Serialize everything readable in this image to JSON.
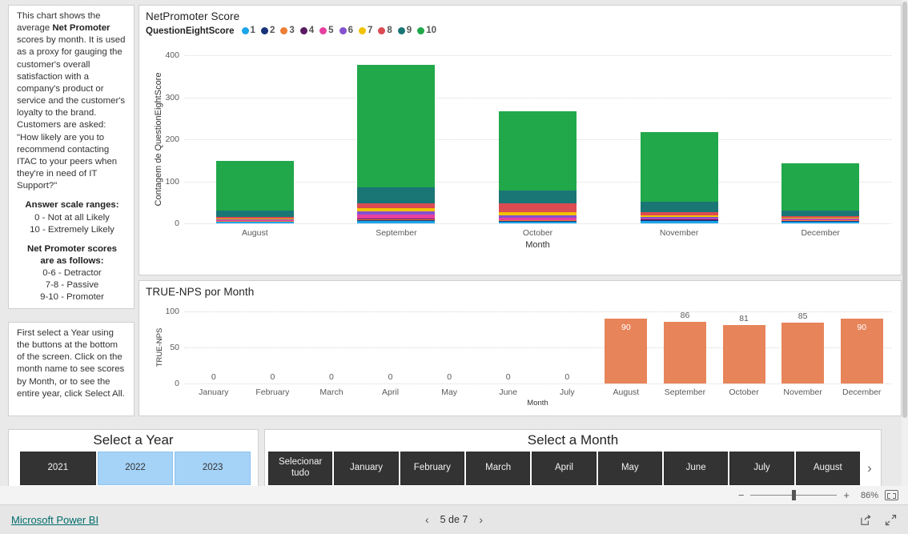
{
  "description_panel": {
    "paragraph": "This chart shows the average Net Promoter scores by month. It is used as a proxy for gauging the customer's overall satisfaction with a company's product or service and the customer's loyalty to the brand. Customers are asked: \"How likely are you to recommend contacting ITAC to your peers when they're in need of IT Support?\"",
    "scale_heading": "Answer scale ranges:",
    "scale_line1": "0 - Not at all Likely",
    "scale_line2": "10 - Extremely Likely",
    "nps_heading_line1": "Net Promoter scores",
    "nps_heading_line2": "are as follows:",
    "nps_line1": "0-6 - Detractor",
    "nps_line2": "7-8 - Passive",
    "nps_line3": "9-10 - Promoter"
  },
  "instructions_panel": {
    "text": "First select a Year using the buttons at the bottom of the screen. Click on the month name to see scores by Month, or to see the entire year, click Select All."
  },
  "chart_data": [
    {
      "id": "net_promoter_score",
      "type": "bar",
      "stacked": true,
      "title": "NetPromoter Score",
      "legend_title": "QuestionEightScore",
      "legend_position": "top",
      "xlabel": "Month",
      "ylabel": "Contagem de QuestionEightScore",
      "ylim": [
        0,
        400
      ],
      "yticks": [
        0,
        100,
        200,
        300,
        400
      ],
      "grid": true,
      "categories": [
        "August",
        "September",
        "October",
        "November",
        "December"
      ],
      "series": [
        {
          "name": "1",
          "color": "#1CA5E8",
          "values": [
            3,
            5,
            3,
            5,
            4
          ]
        },
        {
          "name": "2",
          "color": "#17347A",
          "values": [
            1,
            3,
            2,
            2,
            2
          ]
        },
        {
          "name": "3",
          "color": "#EE7D36",
          "values": [
            1,
            2,
            2,
            1,
            1
          ]
        },
        {
          "name": "4",
          "color": "#5A1A62",
          "values": [
            1,
            2,
            1,
            1,
            1
          ]
        },
        {
          "name": "5",
          "color": "#E63FA0",
          "values": [
            2,
            9,
            6,
            3,
            2
          ]
        },
        {
          "name": "6",
          "color": "#8452CE",
          "values": [
            2,
            7,
            5,
            3,
            2
          ]
        },
        {
          "name": "7",
          "color": "#F2C200",
          "values": [
            2,
            8,
            7,
            4,
            2
          ]
        },
        {
          "name": "8",
          "color": "#DC4B52",
          "values": [
            4,
            12,
            21,
            7,
            4
          ]
        },
        {
          "name": "9",
          "color": "#1A7575",
          "values": [
            14,
            38,
            32,
            25,
            13
          ]
        },
        {
          "name": "10",
          "color": "#21A84A",
          "values": [
            119,
            291,
            188,
            166,
            112
          ]
        }
      ],
      "totals": [
        149,
        377,
        267,
        217,
        143
      ]
    },
    {
      "id": "true_nps_por_month",
      "type": "bar",
      "title": "TRUE-NPS por Month",
      "xlabel": "Month",
      "ylabel": "TRUE-NPS",
      "ylim": [
        0,
        100
      ],
      "yticks": [
        0,
        50,
        100
      ],
      "grid": true,
      "bar_color": "#E8845A",
      "categories": [
        "January",
        "February",
        "March",
        "April",
        "May",
        "June",
        "July",
        "August",
        "September",
        "October",
        "November",
        "December"
      ],
      "values": [
        0,
        0,
        0,
        0,
        0,
        0,
        0,
        90,
        86,
        81,
        85,
        90
      ],
      "label_inside": [
        false,
        false,
        false,
        false,
        false,
        false,
        false,
        true,
        false,
        false,
        false,
        true
      ]
    }
  ],
  "year_slicer": {
    "header": "Select a Year",
    "items": [
      {
        "label": "2021",
        "selected": true
      },
      {
        "label": "2022",
        "selected": false
      },
      {
        "label": "2023",
        "selected": false
      }
    ]
  },
  "month_slicer": {
    "header": "Select a Month",
    "items": [
      {
        "label": "Selecionar tudo",
        "selected": true
      },
      {
        "label": "January",
        "selected": true
      },
      {
        "label": "February",
        "selected": true
      },
      {
        "label": "March",
        "selected": true
      },
      {
        "label": "April",
        "selected": true
      },
      {
        "label": "May",
        "selected": true
      },
      {
        "label": "June",
        "selected": true
      },
      {
        "label": "July",
        "selected": true
      },
      {
        "label": "August",
        "selected": true
      }
    ],
    "next_icon": "chevron-right-icon"
  },
  "statusbar": {
    "zoom_minus": "−",
    "zoom_plus": "+",
    "zoom_percent": "86%",
    "fit_icon": "fit-to-page-icon"
  },
  "footer": {
    "brand": "Microsoft Power BI",
    "prev_icon": "‹",
    "page_text": "5 de 7",
    "next_icon": "›",
    "share_icon": "share-icon",
    "fullscreen_icon": "fullscreen-icon"
  }
}
